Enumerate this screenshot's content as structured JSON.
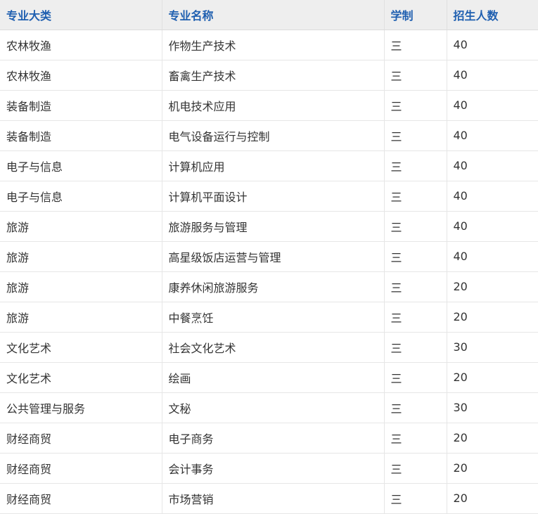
{
  "table": {
    "headers": [
      "专业大类",
      "专业名称",
      "学制",
      "招生人数"
    ],
    "rows": [
      {
        "category": "农林牧渔",
        "major": "作物生产技术",
        "years": "三",
        "enrollment": "40"
      },
      {
        "category": "农林牧渔",
        "major": "畜禽生产技术",
        "years": "三",
        "enrollment": "40"
      },
      {
        "category": "装备制造",
        "major": "机电技术应用",
        "years": "三",
        "enrollment": "40"
      },
      {
        "category": "装备制造",
        "major": "电气设备运行与控制",
        "years": "三",
        "enrollment": "40"
      },
      {
        "category": "电子与信息",
        "major": "计算机应用",
        "years": "三",
        "enrollment": "40"
      },
      {
        "category": "电子与信息",
        "major": "计算机平面设计",
        "years": "三",
        "enrollment": "40"
      },
      {
        "category": "旅游",
        "major": "旅游服务与管理",
        "years": "三",
        "enrollment": "40"
      },
      {
        "category": "旅游",
        "major": "高星级饭店运营与管理",
        "years": "三",
        "enrollment": "40"
      },
      {
        "category": "旅游",
        "major": "康养休闲旅游服务",
        "years": "三",
        "enrollment": "20"
      },
      {
        "category": "旅游",
        "major": "中餐烹饪",
        "years": "三",
        "enrollment": "20"
      },
      {
        "category": "文化艺术",
        "major": "社会文化艺术",
        "years": "三",
        "enrollment": "30"
      },
      {
        "category": "文化艺术",
        "major": "绘画",
        "years": "三",
        "enrollment": "20"
      },
      {
        "category": "公共管理与服务",
        "major": "文秘",
        "years": "三",
        "enrollment": "30"
      },
      {
        "category": "财经商贸",
        "major": "电子商务",
        "years": "三",
        "enrollment": "20"
      },
      {
        "category": "财经商贸",
        "major": "会计事务",
        "years": "三",
        "enrollment": "20"
      },
      {
        "category": "财经商贸",
        "major": "市场营销",
        "years": "三",
        "enrollment": "20"
      }
    ]
  },
  "colors": {
    "header_text": "#1f5fb0",
    "header_bg": "#eeeeee",
    "body_text": "#333333",
    "grid_line": "#e6e6e6"
  }
}
